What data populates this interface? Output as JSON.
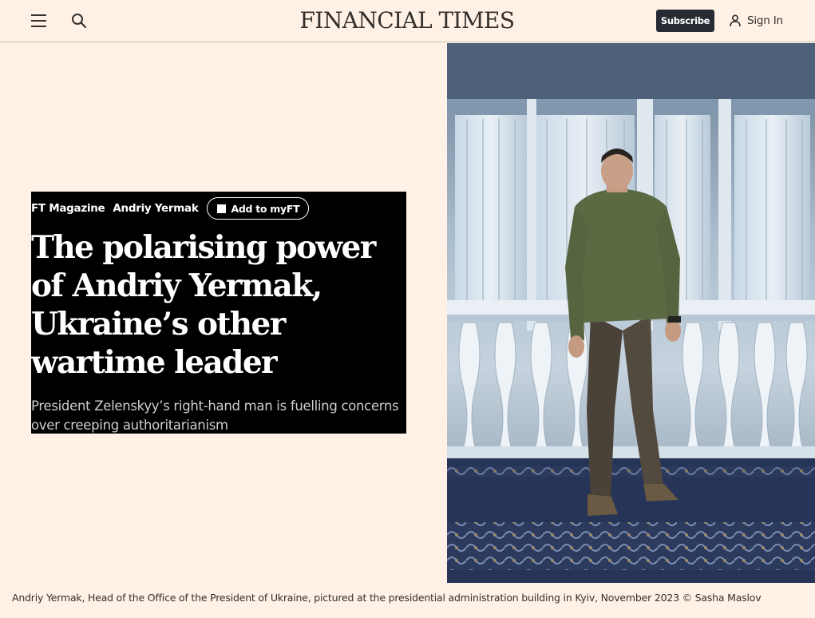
{
  "header": {
    "menu_icon": "hamburger-menu-icon",
    "search_icon": "search-icon",
    "logo": "FINANCIAL TIMES",
    "subscribe_label": "Subscribe",
    "signin_label": "Sign In",
    "user_icon": "user-icon"
  },
  "article": {
    "tags": [
      "FT Magazine",
      "Andriy Yermak"
    ],
    "myft_label": "Add to myFT",
    "headline": "The polarising power of Andriy Yermak, Ukraine’s other wartime leader",
    "standfirst": "President Zelenskyy’s right-hand man is fuelling concerns over creeping authoritarianism",
    "caption": "Andriy Yermak, Head of the Office of the President of Ukraine, pictured at the presidential administration building in Kyiv, November 2023 © Sasha Maslov"
  },
  "colors": {
    "page_bg": "#fff1e5",
    "hero_text_bg": "#000000",
    "subscribe_bg": "#262a33",
    "text": "#33302e"
  }
}
